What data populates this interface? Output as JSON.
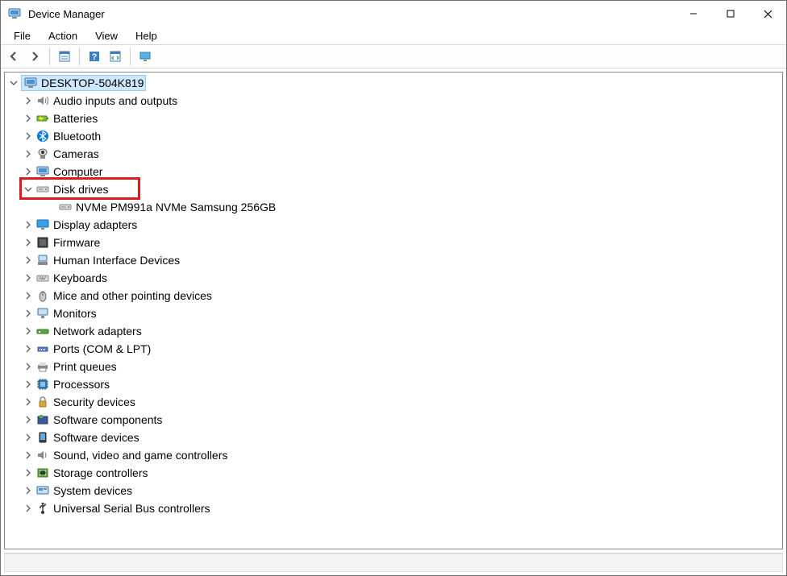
{
  "window": {
    "title": "Device Manager"
  },
  "menu": {
    "file": "File",
    "action": "Action",
    "view": "View",
    "help": "Help"
  },
  "tree": {
    "root": "DESKTOP-504K819",
    "categories": [
      {
        "label": "Audio inputs and outputs",
        "icon": "audio"
      },
      {
        "label": "Batteries",
        "icon": "battery"
      },
      {
        "label": "Bluetooth",
        "icon": "bluetooth"
      },
      {
        "label": "Cameras",
        "icon": "camera"
      },
      {
        "label": "Computer",
        "icon": "computer"
      },
      {
        "label": "Disk drives",
        "icon": "disk",
        "expanded": true,
        "highlighted": true,
        "children": [
          {
            "label": "NVMe PM991a NVMe Samsung 256GB",
            "icon": "disk"
          }
        ]
      },
      {
        "label": "Display adapters",
        "icon": "display"
      },
      {
        "label": "Firmware",
        "icon": "firmware"
      },
      {
        "label": "Human Interface Devices",
        "icon": "hid"
      },
      {
        "label": "Keyboards",
        "icon": "keyboard"
      },
      {
        "label": "Mice and other pointing devices",
        "icon": "mouse"
      },
      {
        "label": "Monitors",
        "icon": "monitor"
      },
      {
        "label": "Network adapters",
        "icon": "network"
      },
      {
        "label": "Ports (COM & LPT)",
        "icon": "port"
      },
      {
        "label": "Print queues",
        "icon": "printer"
      },
      {
        "label": "Processors",
        "icon": "cpu"
      },
      {
        "label": "Security devices",
        "icon": "security"
      },
      {
        "label": "Software components",
        "icon": "swcomp"
      },
      {
        "label": "Software devices",
        "icon": "swdev"
      },
      {
        "label": "Sound, video and game controllers",
        "icon": "sound"
      },
      {
        "label": "Storage controllers",
        "icon": "storage"
      },
      {
        "label": "System devices",
        "icon": "system"
      },
      {
        "label": "Universal Serial Bus controllers",
        "icon": "usb"
      }
    ]
  }
}
